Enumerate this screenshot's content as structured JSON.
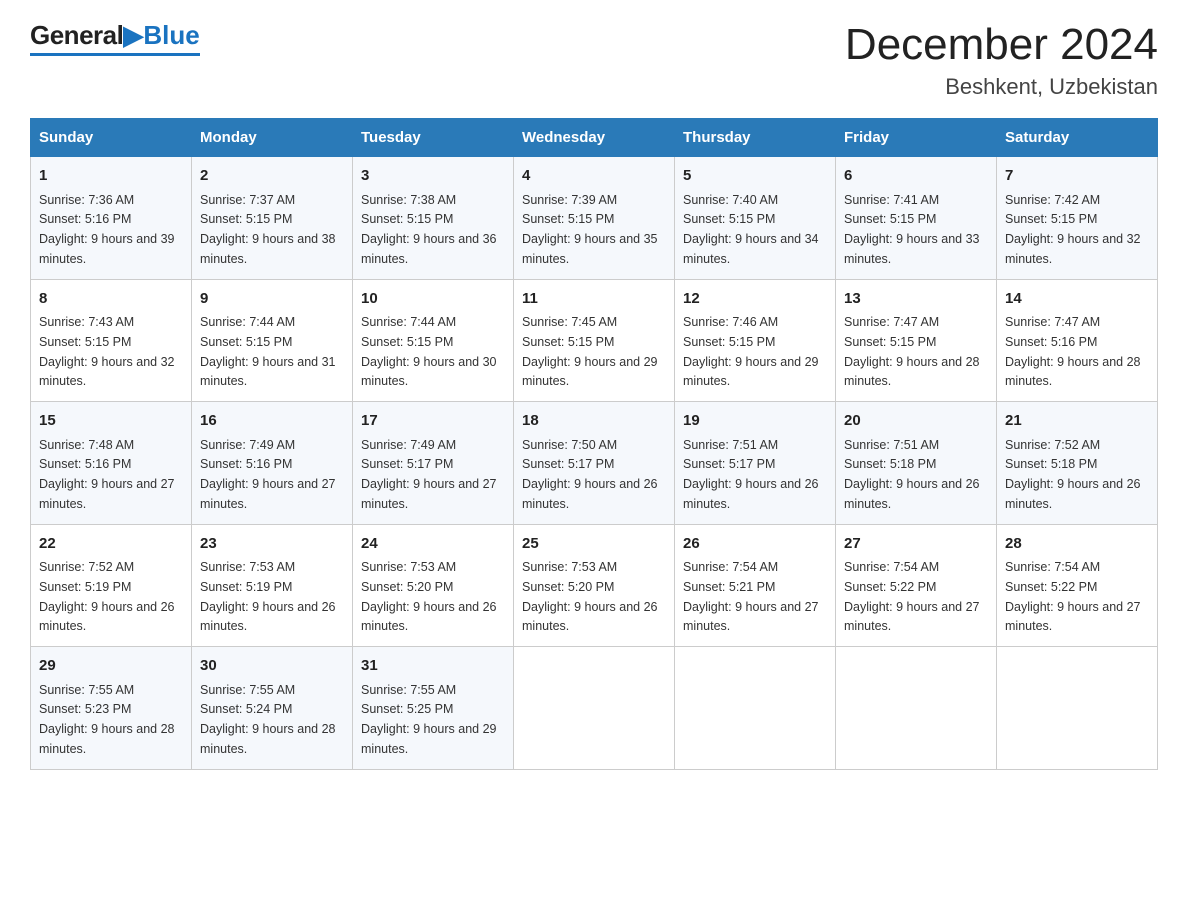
{
  "logo": {
    "general": "General",
    "blue": "Blue",
    "tagline": "Blue"
  },
  "title": "December 2024",
  "subtitle": "Beshkent, Uzbekistan",
  "headers": [
    "Sunday",
    "Monday",
    "Tuesday",
    "Wednesday",
    "Thursday",
    "Friday",
    "Saturday"
  ],
  "weeks": [
    [
      {
        "day": "1",
        "sunrise": "7:36 AM",
        "sunset": "5:16 PM",
        "daylight": "9 hours and 39 minutes."
      },
      {
        "day": "2",
        "sunrise": "7:37 AM",
        "sunset": "5:15 PM",
        "daylight": "9 hours and 38 minutes."
      },
      {
        "day": "3",
        "sunrise": "7:38 AM",
        "sunset": "5:15 PM",
        "daylight": "9 hours and 36 minutes."
      },
      {
        "day": "4",
        "sunrise": "7:39 AM",
        "sunset": "5:15 PM",
        "daylight": "9 hours and 35 minutes."
      },
      {
        "day": "5",
        "sunrise": "7:40 AM",
        "sunset": "5:15 PM",
        "daylight": "9 hours and 34 minutes."
      },
      {
        "day": "6",
        "sunrise": "7:41 AM",
        "sunset": "5:15 PM",
        "daylight": "9 hours and 33 minutes."
      },
      {
        "day": "7",
        "sunrise": "7:42 AM",
        "sunset": "5:15 PM",
        "daylight": "9 hours and 32 minutes."
      }
    ],
    [
      {
        "day": "8",
        "sunrise": "7:43 AM",
        "sunset": "5:15 PM",
        "daylight": "9 hours and 32 minutes."
      },
      {
        "day": "9",
        "sunrise": "7:44 AM",
        "sunset": "5:15 PM",
        "daylight": "9 hours and 31 minutes."
      },
      {
        "day": "10",
        "sunrise": "7:44 AM",
        "sunset": "5:15 PM",
        "daylight": "9 hours and 30 minutes."
      },
      {
        "day": "11",
        "sunrise": "7:45 AM",
        "sunset": "5:15 PM",
        "daylight": "9 hours and 29 minutes."
      },
      {
        "day": "12",
        "sunrise": "7:46 AM",
        "sunset": "5:15 PM",
        "daylight": "9 hours and 29 minutes."
      },
      {
        "day": "13",
        "sunrise": "7:47 AM",
        "sunset": "5:15 PM",
        "daylight": "9 hours and 28 minutes."
      },
      {
        "day": "14",
        "sunrise": "7:47 AM",
        "sunset": "5:16 PM",
        "daylight": "9 hours and 28 minutes."
      }
    ],
    [
      {
        "day": "15",
        "sunrise": "7:48 AM",
        "sunset": "5:16 PM",
        "daylight": "9 hours and 27 minutes."
      },
      {
        "day": "16",
        "sunrise": "7:49 AM",
        "sunset": "5:16 PM",
        "daylight": "9 hours and 27 minutes."
      },
      {
        "day": "17",
        "sunrise": "7:49 AM",
        "sunset": "5:17 PM",
        "daylight": "9 hours and 27 minutes."
      },
      {
        "day": "18",
        "sunrise": "7:50 AM",
        "sunset": "5:17 PM",
        "daylight": "9 hours and 26 minutes."
      },
      {
        "day": "19",
        "sunrise": "7:51 AM",
        "sunset": "5:17 PM",
        "daylight": "9 hours and 26 minutes."
      },
      {
        "day": "20",
        "sunrise": "7:51 AM",
        "sunset": "5:18 PM",
        "daylight": "9 hours and 26 minutes."
      },
      {
        "day": "21",
        "sunrise": "7:52 AM",
        "sunset": "5:18 PM",
        "daylight": "9 hours and 26 minutes."
      }
    ],
    [
      {
        "day": "22",
        "sunrise": "7:52 AM",
        "sunset": "5:19 PM",
        "daylight": "9 hours and 26 minutes."
      },
      {
        "day": "23",
        "sunrise": "7:53 AM",
        "sunset": "5:19 PM",
        "daylight": "9 hours and 26 minutes."
      },
      {
        "day": "24",
        "sunrise": "7:53 AM",
        "sunset": "5:20 PM",
        "daylight": "9 hours and 26 minutes."
      },
      {
        "day": "25",
        "sunrise": "7:53 AM",
        "sunset": "5:20 PM",
        "daylight": "9 hours and 26 minutes."
      },
      {
        "day": "26",
        "sunrise": "7:54 AM",
        "sunset": "5:21 PM",
        "daylight": "9 hours and 27 minutes."
      },
      {
        "day": "27",
        "sunrise": "7:54 AM",
        "sunset": "5:22 PM",
        "daylight": "9 hours and 27 minutes."
      },
      {
        "day": "28",
        "sunrise": "7:54 AM",
        "sunset": "5:22 PM",
        "daylight": "9 hours and 27 minutes."
      }
    ],
    [
      {
        "day": "29",
        "sunrise": "7:55 AM",
        "sunset": "5:23 PM",
        "daylight": "9 hours and 28 minutes."
      },
      {
        "day": "30",
        "sunrise": "7:55 AM",
        "sunset": "5:24 PM",
        "daylight": "9 hours and 28 minutes."
      },
      {
        "day": "31",
        "sunrise": "7:55 AM",
        "sunset": "5:25 PM",
        "daylight": "9 hours and 29 minutes."
      },
      null,
      null,
      null,
      null
    ]
  ],
  "sunrise_label": "Sunrise: ",
  "sunset_label": "Sunset: ",
  "daylight_label": "Daylight: "
}
